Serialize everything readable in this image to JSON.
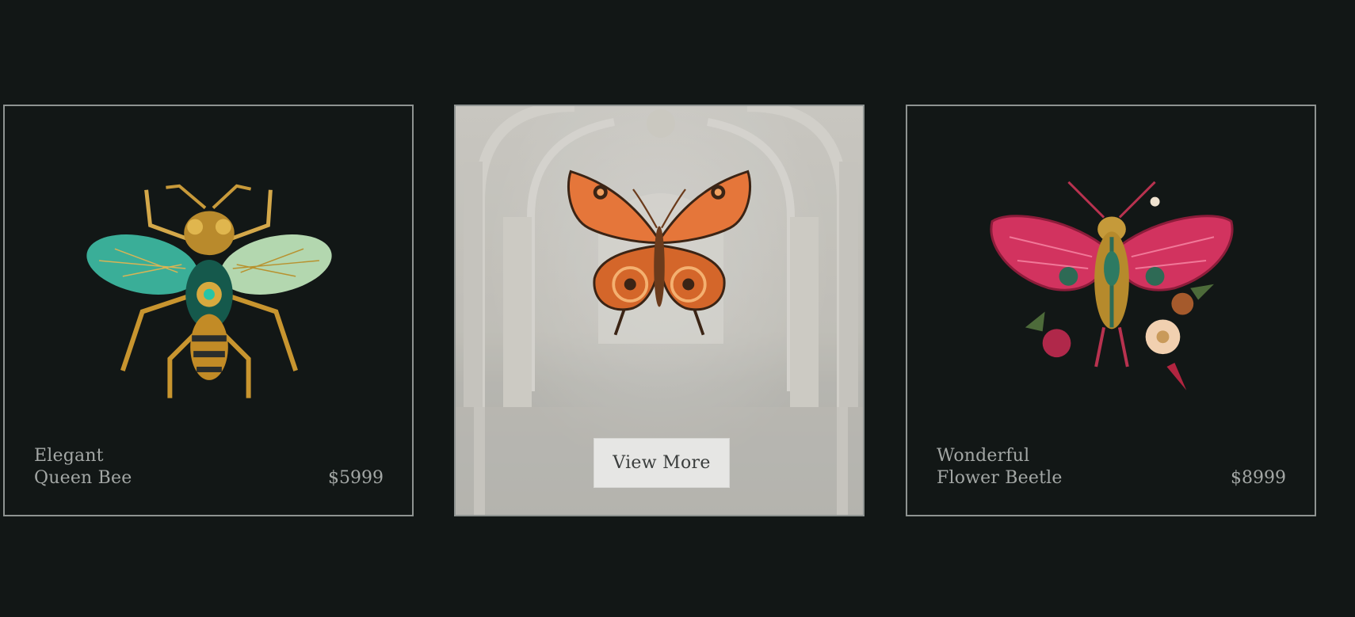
{
  "products": [
    {
      "name_line1": "Elegant",
      "name_line2": "Queen Bee",
      "price": "$5999",
      "image": "mechanical-bee-icon"
    },
    {
      "image": "mechanical-butterfly-icon",
      "cta_label": "View More"
    },
    {
      "name_line1": "Wonderful",
      "name_line2": "Flower Beetle",
      "price": "$8999",
      "image": "floral-beetle-icon"
    }
  ],
  "colors": {
    "background": "#121716",
    "card_border": "#8e9391",
    "text": "#a3a7a5",
    "button_bg": "#e6e6e4"
  }
}
